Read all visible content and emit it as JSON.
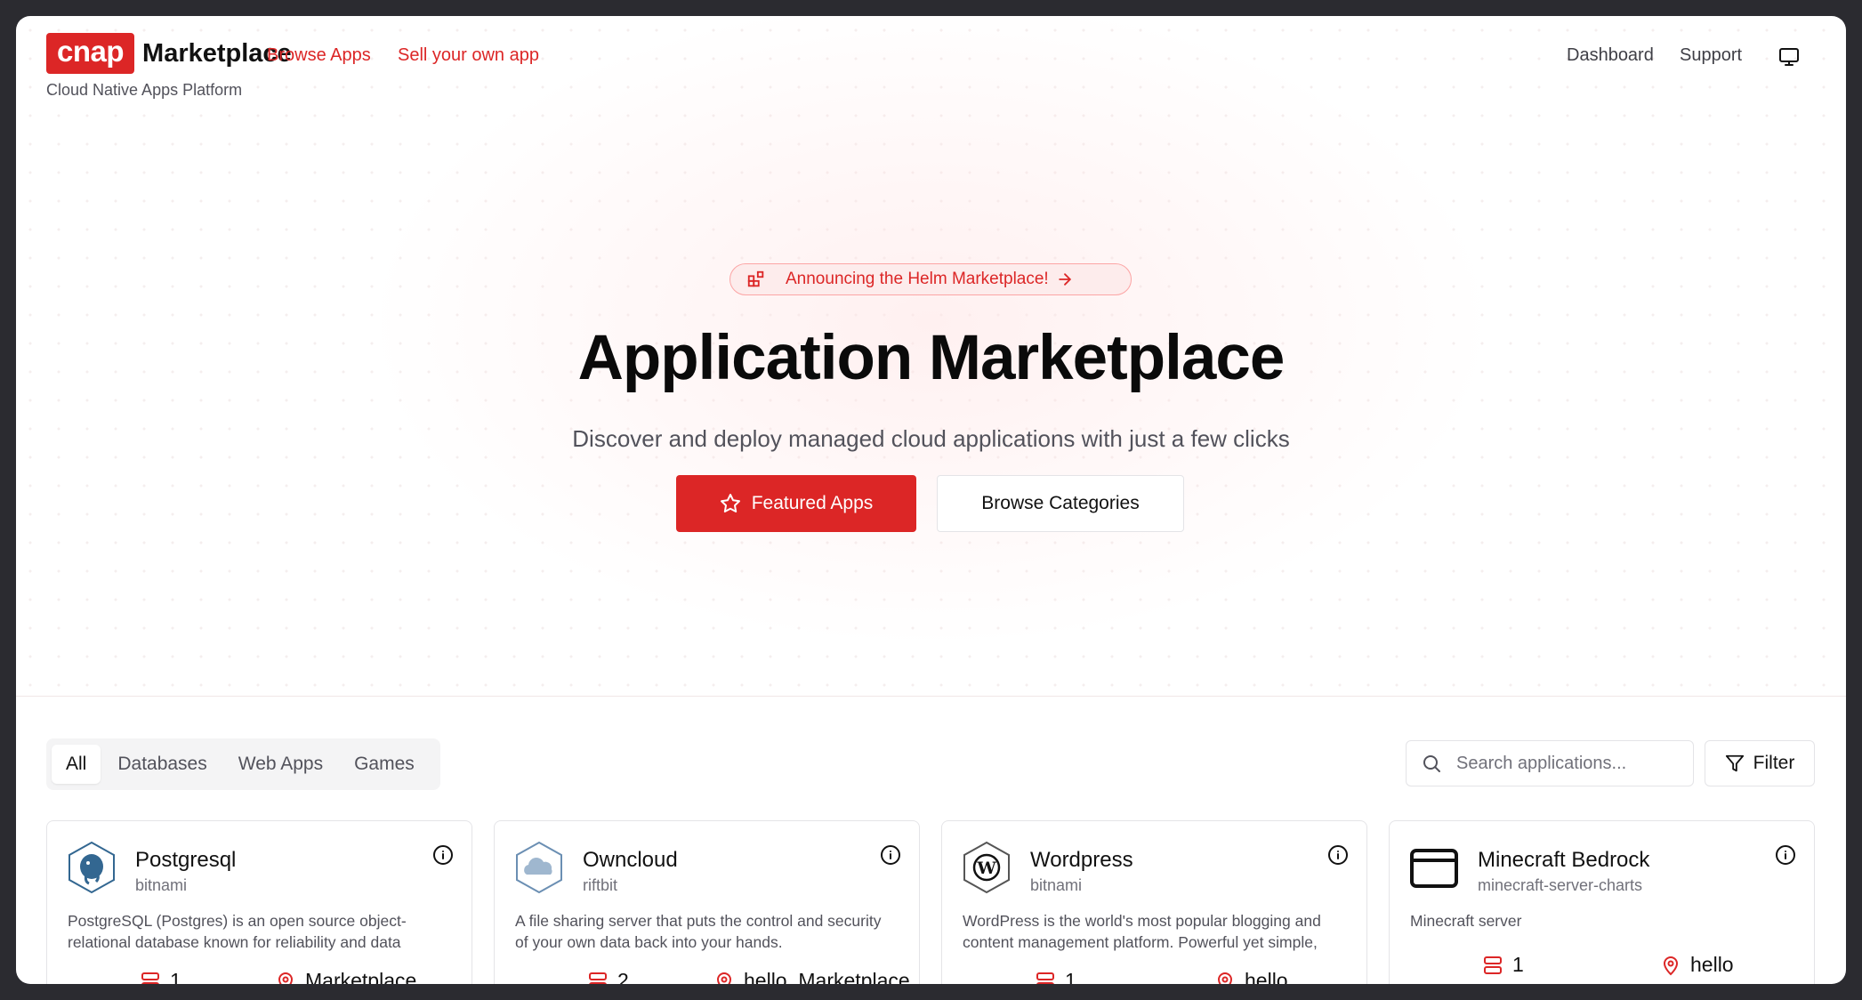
{
  "header": {
    "logo_mark": "cnap",
    "logo_name": "Marketplace",
    "tagline": "Cloud Native Apps Platform",
    "nav": [
      {
        "label": "Browse Apps"
      },
      {
        "label": "Sell your own app"
      }
    ],
    "right_nav": [
      {
        "label": "Dashboard"
      },
      {
        "label": "Support"
      }
    ],
    "display_icon": "monitor-icon"
  },
  "hero": {
    "announcement": "Announcing the Helm Marketplace!",
    "title": "Application Marketplace",
    "subtitle": "Discover and deploy managed cloud applications with just a few clicks",
    "primary_button": "Featured Apps",
    "secondary_button": "Browse Categories"
  },
  "filters": {
    "tabs": [
      "All",
      "Databases",
      "Web Apps",
      "Games"
    ],
    "active_tab": "All",
    "search_placeholder": "Search applications...",
    "filter_label": "Filter"
  },
  "apps": [
    {
      "name": "Postgresql",
      "vendor": "bitnami",
      "description": "PostgreSQL (Postgres) is an open source object-relational database known for reliability and data integrity.",
      "icon": "elephant-icon",
      "count": "1",
      "location": "Marketplace"
    },
    {
      "name": "Owncloud",
      "vendor": "riftbit",
      "description": "A file sharing server that puts the control and security of your own data back into your hands.",
      "icon": "cloud-icon",
      "count": "2",
      "location": "hello, Marketplace"
    },
    {
      "name": "Wordpress",
      "vendor": "bitnami",
      "description": "WordPress is the world's most popular blogging and content management platform. Powerful yet simple, everyone can use it.",
      "icon": "wordpress-icon",
      "count": "1",
      "location": "hello"
    },
    {
      "name": "Minecraft Bedrock",
      "vendor": "minecraft-server-charts",
      "description": "Minecraft server",
      "icon": "browser-window-icon",
      "count": "1",
      "location": "hello"
    }
  ],
  "colors": {
    "accent": "#dc2626",
    "text": "#18181b",
    "muted": "#71717a",
    "border": "#e4e4e7"
  }
}
